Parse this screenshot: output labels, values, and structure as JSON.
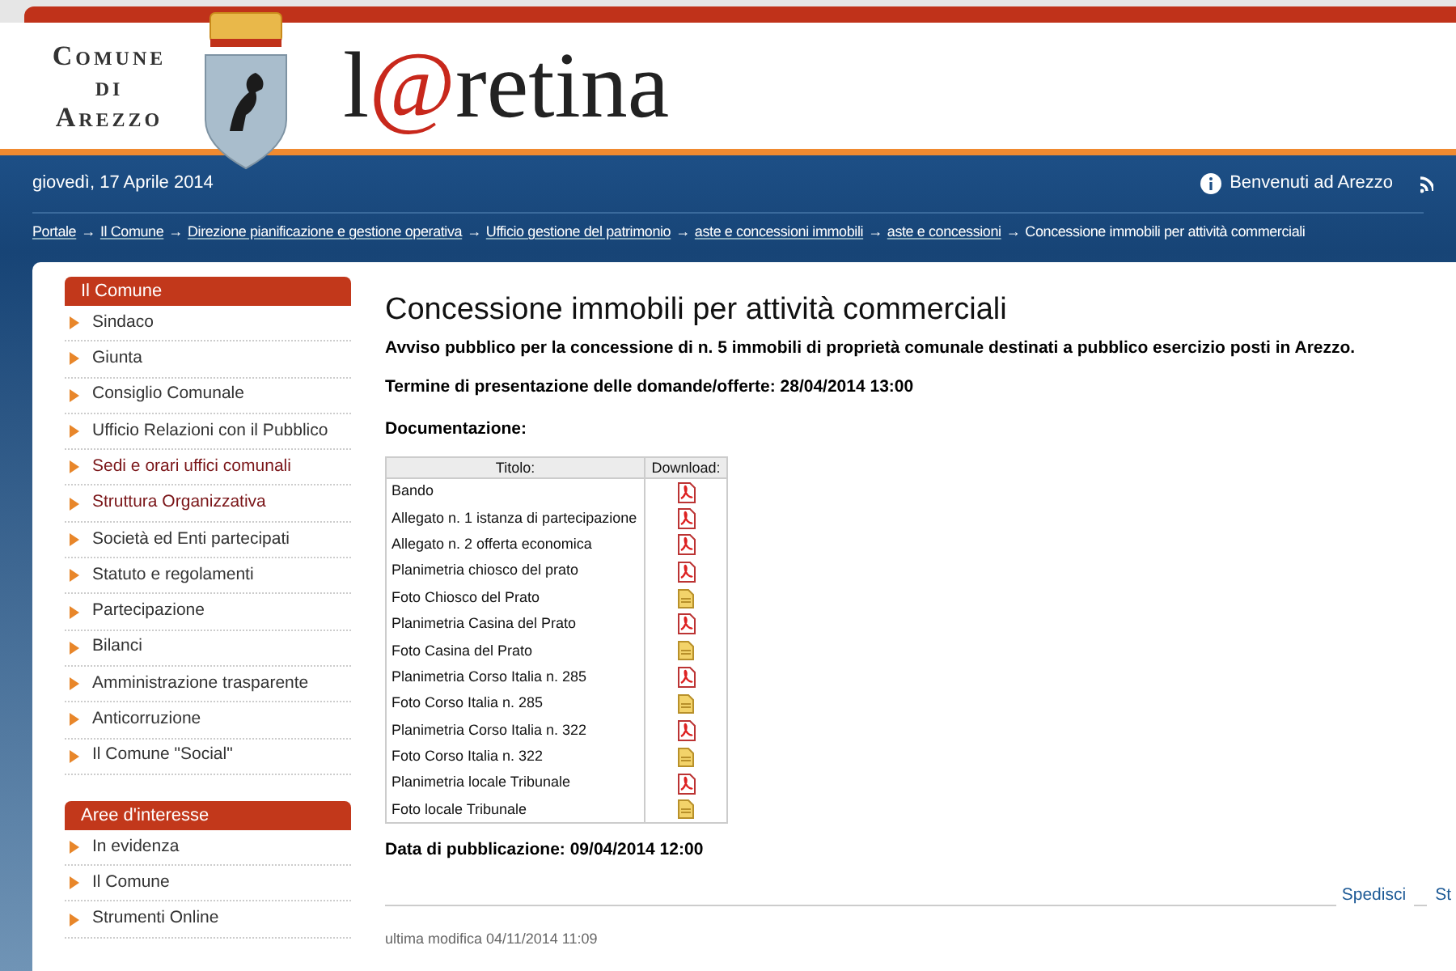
{
  "header": {
    "municipality": [
      "Comune",
      "di",
      "Arezzo"
    ],
    "logo": [
      {
        "text": "l",
        "accent": false
      },
      {
        "text": "@",
        "accent": true
      },
      {
        "text": "retina",
        "accent": false
      }
    ]
  },
  "topbar": {
    "date": "giovedì, 17 Aprile 2014",
    "welcome": "Benvenuti ad Arezzo"
  },
  "breadcrumb": {
    "separator": "→",
    "links": [
      "Portale",
      "Il Comune",
      "Direzione pianificazione e gestione operativa",
      "Ufficio gestione del patrimonio",
      "aste e concessioni immobili",
      "aste e concessioni"
    ],
    "current": "Concessione immobili per attività commerciali"
  },
  "sidebar": [
    {
      "title": "Il Comune",
      "items": [
        {
          "label": "Sindaco",
          "visited": false
        },
        {
          "label": "Giunta",
          "visited": false
        },
        {
          "label": "Consiglio Comunale",
          "visited": false
        },
        {
          "label": "Ufficio Relazioni con il Pubblico",
          "visited": false
        },
        {
          "label": "Sedi e orari uffici comunali",
          "visited": true
        },
        {
          "label": "Struttura Organizzativa",
          "visited": true
        },
        {
          "label": "Società ed Enti partecipati",
          "visited": false
        },
        {
          "label": "Statuto e regolamenti",
          "visited": false
        },
        {
          "label": "Partecipazione",
          "visited": false
        },
        {
          "label": "Bilanci",
          "visited": false
        },
        {
          "label": "Amministrazione trasparente",
          "visited": false
        },
        {
          "label": "Anticorruzione",
          "visited": false
        },
        {
          "label": "Il Comune \"Social\"",
          "visited": false
        }
      ]
    },
    {
      "title": "Aree d'interesse",
      "items": [
        {
          "label": "In evidenza",
          "visited": false
        },
        {
          "label": "Il Comune",
          "visited": false
        },
        {
          "label": "Strumenti Online",
          "visited": false
        }
      ]
    }
  ],
  "content": {
    "title": "Concessione immobili per attività commerciali",
    "notice": "Avviso pubblico per la concessione di n. 5 immobili di proprietà comunale destinati a pubblico esercizio posti in Arezzo.",
    "deadline": "Termine di presentazione delle domande/offerte: 28/04/2014 13:00",
    "docs_label": "Documentazione:",
    "table": {
      "columns": [
        "Titolo:",
        "Download:"
      ],
      "rows": [
        {
          "title": "Bando",
          "kind": "pdf"
        },
        {
          "title": "Allegato n. 1 istanza di partecipazione",
          "kind": "pdf"
        },
        {
          "title": "Allegato n. 2 offerta economica",
          "kind": "pdf"
        },
        {
          "title": "Planimetria chiosco del prato",
          "kind": "pdf"
        },
        {
          "title": "Foto Chiosco del Prato",
          "kind": "image"
        },
        {
          "title": "Planimetria Casina del Prato",
          "kind": "pdf"
        },
        {
          "title": "Foto Casina del Prato",
          "kind": "image"
        },
        {
          "title": "Planimetria Corso Italia n. 285",
          "kind": "pdf"
        },
        {
          "title": "Foto Corso Italia n. 285",
          "kind": "image"
        },
        {
          "title": "Planimetria Corso Italia n. 322",
          "kind": "pdf"
        },
        {
          "title": "Foto Corso Italia n. 322",
          "kind": "image"
        },
        {
          "title": "Planimetria locale Tribunale",
          "kind": "pdf"
        },
        {
          "title": "Foto locale Tribunale",
          "kind": "image"
        }
      ]
    },
    "published": "Data di pubblicazione: 09/04/2014 12:00",
    "actions": [
      "Spedisci",
      "St"
    ],
    "modified": "ultima modifica 04/11/2014 11:09"
  }
}
